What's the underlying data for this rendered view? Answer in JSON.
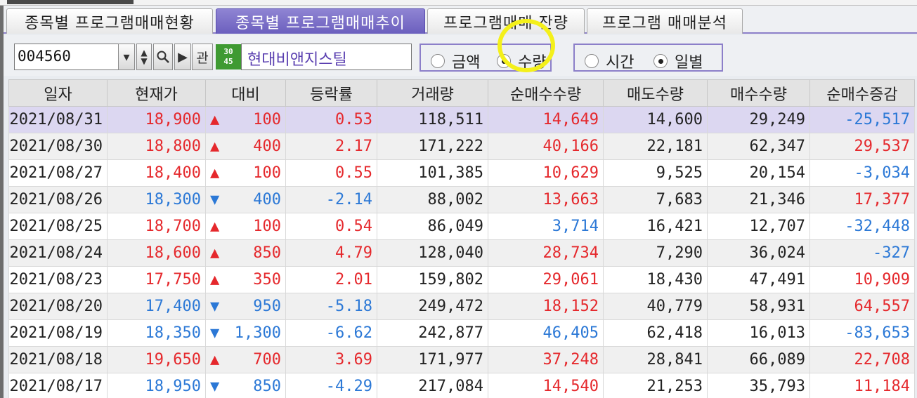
{
  "tabs": [
    {
      "label": "종목별 프로그램매매현황",
      "active": false
    },
    {
      "label": "종목별 프로그램매매추이",
      "active": true
    },
    {
      "label": "프로그램매매 잔량",
      "active": false
    },
    {
      "label": "프로그램 매매분석",
      "active": false
    }
  ],
  "toolbar": {
    "code": "004560",
    "search_icon": "magnifier-icon",
    "play_icon": "play-icon",
    "relation_label": "관",
    "badge_text": "3045",
    "stock_name": "현대비앤지스틸",
    "mode_options": [
      {
        "label": "금액",
        "selected": false
      },
      {
        "label": "수량",
        "selected": true
      }
    ],
    "period_options": [
      {
        "label": "시간",
        "selected": false
      },
      {
        "label": "일별",
        "selected": true
      }
    ]
  },
  "table": {
    "columns": [
      "일자",
      "현재가",
      "대비",
      "등락률",
      "거래량",
      "순매수수량",
      "매도수량",
      "매수수량",
      "순매수증감"
    ],
    "rows": [
      {
        "date": "2021/08/31",
        "price": "18,900",
        "dir": "up",
        "diff": "100",
        "rate": "0.53",
        "volume": "118,511",
        "net": "14,649",
        "sell": "14,600",
        "buy": "29,249",
        "change": "-25,517"
      },
      {
        "date": "2021/08/30",
        "price": "18,800",
        "dir": "up",
        "diff": "400",
        "rate": "2.17",
        "volume": "171,222",
        "net": "40,166",
        "sell": "22,181",
        "buy": "62,347",
        "change": "29,537"
      },
      {
        "date": "2021/08/27",
        "price": "18,400",
        "dir": "up",
        "diff": "100",
        "rate": "0.55",
        "volume": "101,385",
        "net": "10,629",
        "sell": "9,525",
        "buy": "20,154",
        "change": "-3,034"
      },
      {
        "date": "2021/08/26",
        "price": "18,300",
        "dir": "down",
        "diff": "400",
        "rate": "-2.14",
        "volume": "88,002",
        "net": "13,663",
        "sell": "7,683",
        "buy": "21,346",
        "change": "17,377"
      },
      {
        "date": "2021/08/25",
        "price": "18,700",
        "dir": "up",
        "diff": "100",
        "rate": "0.54",
        "volume": "86,049",
        "net": "3,714",
        "sell": "16,421",
        "buy": "12,707",
        "change": "-32,448"
      },
      {
        "date": "2021/08/24",
        "price": "18,600",
        "dir": "up",
        "diff": "850",
        "rate": "4.79",
        "volume": "128,040",
        "net": "28,734",
        "sell": "7,290",
        "buy": "36,024",
        "change": "-327"
      },
      {
        "date": "2021/08/23",
        "price": "17,750",
        "dir": "up",
        "diff": "350",
        "rate": "2.01",
        "volume": "159,802",
        "net": "29,061",
        "sell": "18,430",
        "buy": "47,491",
        "change": "10,909"
      },
      {
        "date": "2021/08/20",
        "price": "17,400",
        "dir": "down",
        "diff": "950",
        "rate": "-5.18",
        "volume": "249,472",
        "net": "18,152",
        "sell": "40,779",
        "buy": "58,931",
        "change": "64,557"
      },
      {
        "date": "2021/08/19",
        "price": "18,350",
        "dir": "down",
        "diff": "1,300",
        "rate": "-6.62",
        "volume": "242,877",
        "net": "46,405",
        "sell": "62,418",
        "buy": "16,013",
        "change": "-83,653"
      },
      {
        "date": "2021/08/18",
        "price": "19,650",
        "dir": "up",
        "diff": "700",
        "rate": "3.69",
        "volume": "171,977",
        "net": "37,248",
        "sell": "28,841",
        "buy": "66,089",
        "change": "22,708"
      },
      {
        "date": "2021/08/17",
        "price": "18,950",
        "dir": "down",
        "diff": "850",
        "rate": "-4.29",
        "volume": "217,084",
        "net": "14,540",
        "sell": "21,253",
        "buy": "35,793",
        "change": "11,184"
      }
    ]
  },
  "colors": {
    "up": "#e5282c",
    "down": "#2b78d6",
    "accent": "#8c7fc9",
    "highlight": "#f4f01a"
  }
}
